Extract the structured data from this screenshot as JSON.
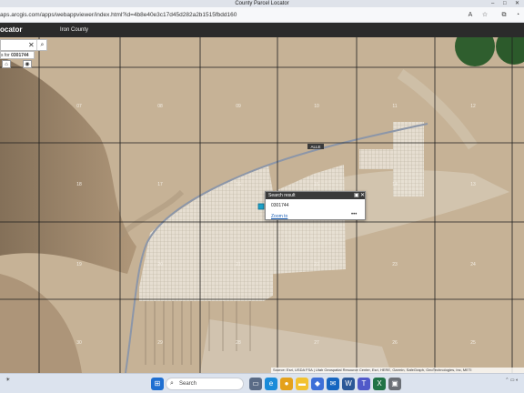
{
  "window": {
    "title": "County Parcel Locator",
    "controls": [
      "–",
      "□",
      "✕"
    ]
  },
  "browser": {
    "url": "aps.arcgis.com/apps/webappviewer/index.html?id=4b8e40e3c17d45d282a2b1515fbdd160",
    "icons": [
      "reader-icon",
      "favorite-icon",
      "collections-icon",
      "profile-icon"
    ]
  },
  "app": {
    "brand": "ocator",
    "county_label": "Iron County"
  },
  "search": {
    "value": "",
    "clear_symbol": "✕",
    "search_symbol": "🔍"
  },
  "suggestion": {
    "prefix": "s for",
    "term": "0301744"
  },
  "map": {
    "section_labels": [
      "07",
      "08",
      "09",
      "10",
      "11",
      "12",
      "18",
      "17",
      "16",
      "15",
      "14",
      "13",
      "19",
      "20",
      "21",
      "22",
      "23",
      "24",
      "30",
      "29",
      "28",
      "27",
      "26",
      "25"
    ],
    "road_label": "ALLE",
    "colors": {
      "terrain": "#c9b69a",
      "parcel": "#e6dfd2",
      "grid": "#1e1e1e",
      "road": "#8c96a8",
      "highlight": "#1da1c8"
    }
  },
  "popup": {
    "title": "Search result",
    "parcel_id": "0301744",
    "zoom_label": "Zoom to",
    "more_label": "•••",
    "maximize_symbol": "▣",
    "close_symbol": "✕"
  },
  "attribution": "Source: Esri, USDA FSA | Utah Geospatial Resource Center, Esri, HERE, Garmin, SafeGraph, GeoTechnologies, Inc, METI",
  "taskbar": {
    "search_label": "Search",
    "apps": [
      "start",
      "search",
      "task-view",
      "edge",
      "chrome",
      "file-explorer",
      "store",
      "mail",
      "word",
      "teams",
      "excel",
      "other"
    ]
  }
}
